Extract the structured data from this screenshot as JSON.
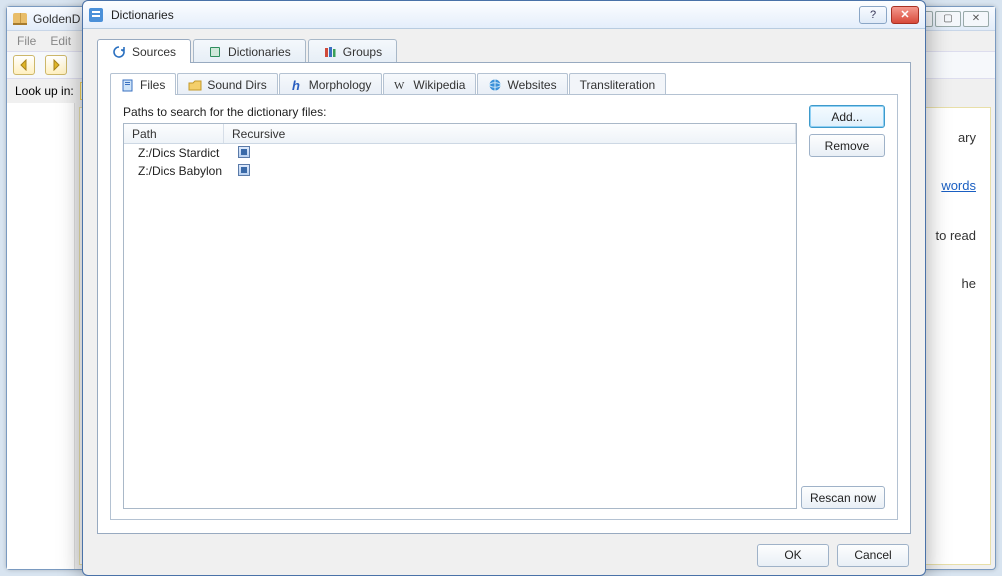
{
  "main": {
    "title": "GoldenD",
    "menus": [
      "File",
      "Edit"
    ],
    "lookup_label": "Look up in:",
    "fragments": {
      "f1": "ary",
      "f2": "words",
      "f3": "to read",
      "f4": "he"
    }
  },
  "dialog": {
    "title": "Dictionaries",
    "outer_tabs": {
      "sources": "Sources",
      "dictionaries": "Dictionaries",
      "groups": "Groups"
    },
    "inner_tabs": {
      "files": "Files",
      "sound": "Sound Dirs",
      "morph": "Morphology",
      "wiki": "Wikipedia",
      "web": "Websites",
      "translit": "Transliteration"
    },
    "paths_label": "Paths to search for the dictionary files:",
    "columns": {
      "path": "Path",
      "recursive": "Recursive"
    },
    "rows": [
      {
        "path": "Z:/Dics Stardict",
        "recursive": true
      },
      {
        "path": "Z:/Dics Babylon",
        "recursive": true
      }
    ],
    "buttons": {
      "add": "Add...",
      "remove": "Remove",
      "rescan": "Rescan now",
      "ok": "OK",
      "cancel": "Cancel"
    }
  }
}
